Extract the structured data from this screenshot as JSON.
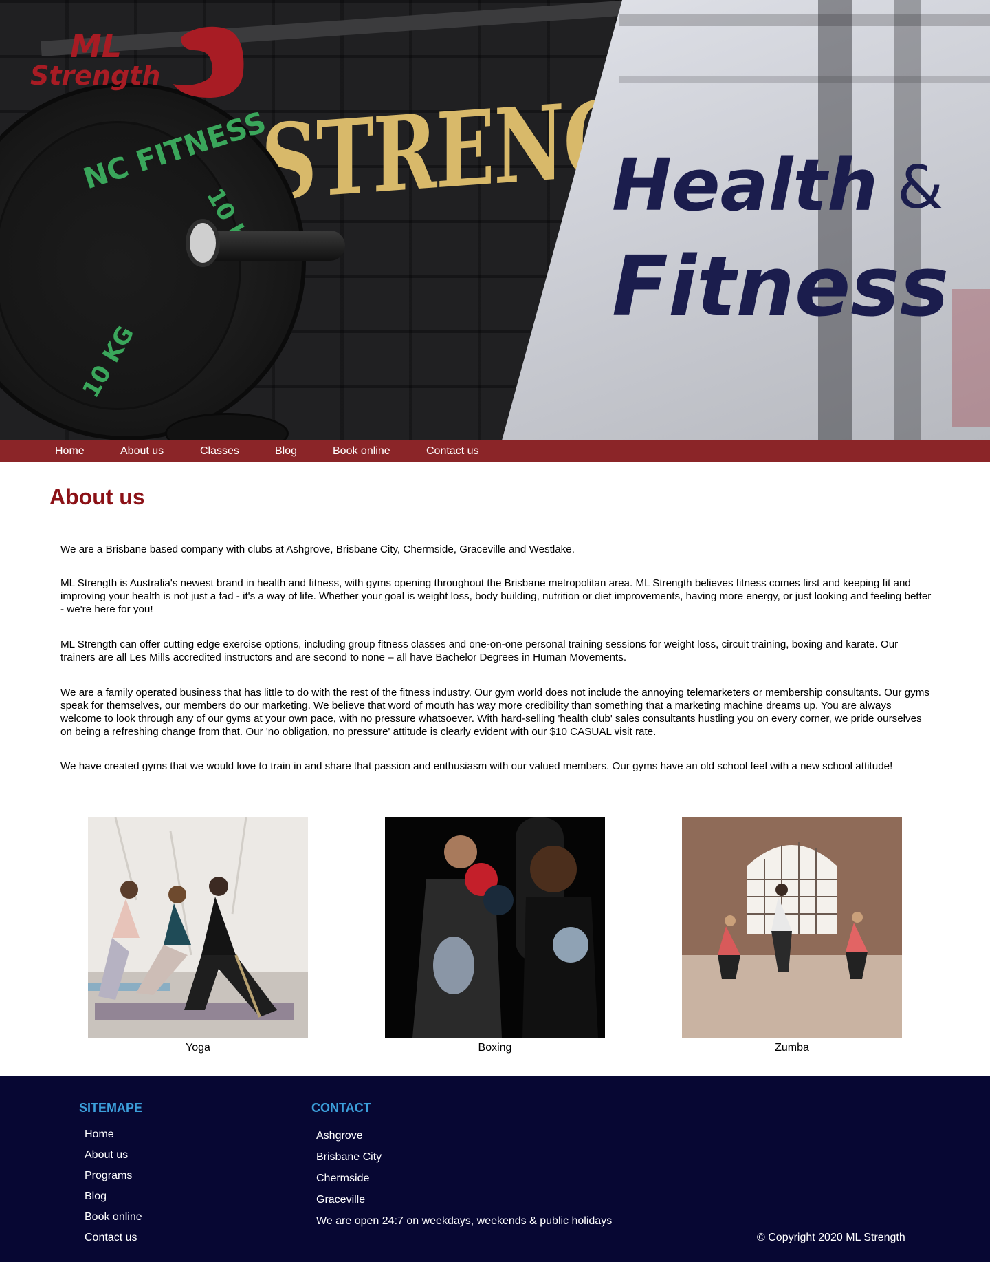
{
  "brand": {
    "logo_line1": "ML",
    "logo_line2": "Strength",
    "accent": "#a81c24",
    "nav_color": "#8b2528",
    "footer_color": "#070733",
    "footer_heading_color": "#3c9fdb"
  },
  "hero": {
    "wall_word": "STRENGTH",
    "plate_text_brand": "NC FITNESS",
    "plate_text_weight": "10 KG",
    "headline_word1": "Health",
    "headline_amp": "&",
    "headline_word2": "Fitness"
  },
  "nav": {
    "items": [
      {
        "label": "Home"
      },
      {
        "label": "About us"
      },
      {
        "label": "Classes"
      },
      {
        "label": "Blog"
      },
      {
        "label": "Book online"
      },
      {
        "label": "Contact us"
      }
    ]
  },
  "main": {
    "title": "About us",
    "paragraphs": [
      "We are a Brisbane based company with clubs at Ashgrove, Brisbane City, Chermside, Graceville and Westlake.",
      "ML Strength is Australia's newest brand in health and fitness, with gyms opening throughout the Brisbane metropolitan area. ML Strength believes fitness comes first and keeping fit and improving your health is not just a fad - it's a way of life. Whether your goal is weight loss, body building, nutrition or diet improvements, having more energy, or just looking and feeling better - we're here for you!",
      "ML Strength can offer cutting edge exercise options, including group fitness classes and one-on-one personal training sessions for weight loss, circuit training, boxing and karate. Our trainers are all Les Mills accredited instructors and are second to none – all have Bachelor Degrees in Human Movements.",
      "We are a family operated business that has little to do with the rest of the fitness industry. Our gym world does not include the annoying telemarketers or membership consultants. Our gyms speak for themselves, our members do our marketing. We believe that word of mouth has way more credibility than something that a marketing machine dreams up. You are always welcome to look through any of our gyms at your own pace, with no pressure whatsoever. With hard-selling 'health club' sales consultants hustling you on every corner, we pride ourselves on being a refreshing change from that. Our 'no obligation, no pressure' attitude is clearly evident with our $10 CASUAL visit rate.",
      "We have created gyms that we would love to train in and share that passion and enthusiasm with our valued members. Our gyms have an old school feel with a new school attitude!"
    ],
    "gallery": [
      {
        "caption": "Yoga"
      },
      {
        "caption": "Boxing"
      },
      {
        "caption": "Zumba"
      }
    ]
  },
  "footer": {
    "sitemap_heading": "SITEMAPE",
    "sitemap_links": [
      "Home",
      "About us",
      "Programs",
      "Blog",
      "Book online",
      "Contact us"
    ],
    "contact_heading": "CONTACT",
    "contact_lines": [
      "Ashgrove",
      "Brisbane City",
      "Chermside",
      "Graceville",
      "We are open 24:7 on weekdays, weekends & public holidays"
    ],
    "copyright": "© Copyright 2020 ML Strength"
  }
}
